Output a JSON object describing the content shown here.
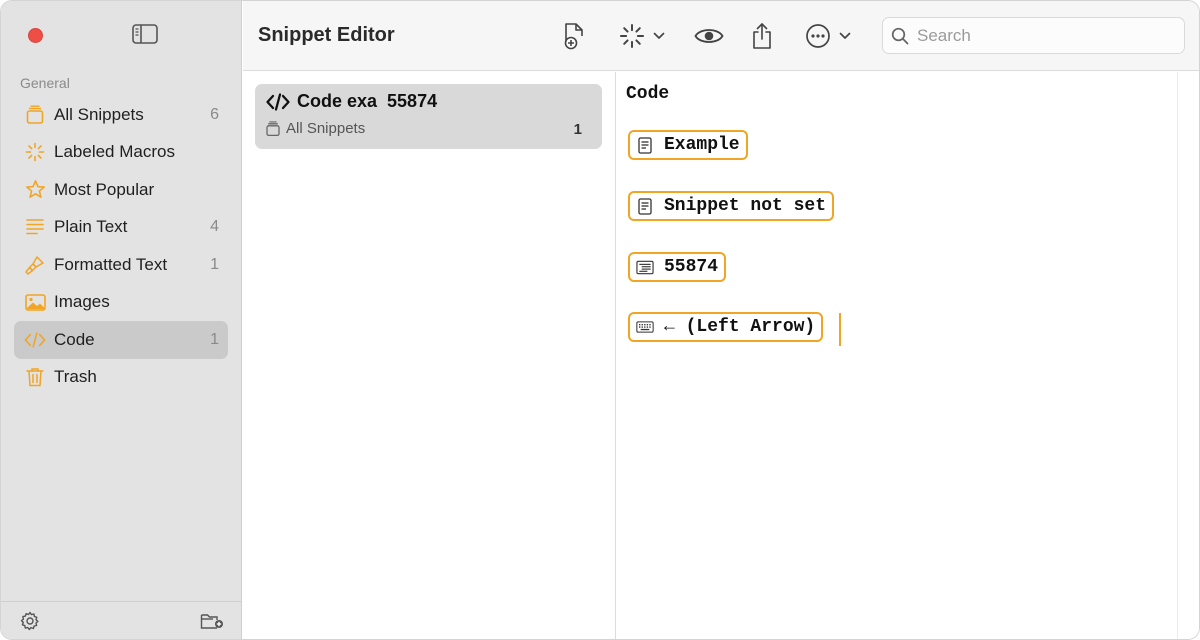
{
  "sidebar": {
    "section_label": "General",
    "items": [
      {
        "label": "All Snippets",
        "count": "6",
        "icon": "stack-icon"
      },
      {
        "label": "Labeled Macros",
        "count": "",
        "icon": "sparkle-icon"
      },
      {
        "label": "Most Popular",
        "count": "",
        "icon": "star-icon"
      },
      {
        "label": "Plain Text",
        "count": "4",
        "icon": "lines-icon"
      },
      {
        "label": "Formatted Text",
        "count": "1",
        "icon": "brush-icon"
      },
      {
        "label": "Images",
        "count": "",
        "icon": "photo-icon"
      },
      {
        "label": "Code",
        "count": "1",
        "icon": "code-icon"
      },
      {
        "label": "Trash",
        "count": "",
        "icon": "trash-icon"
      }
    ],
    "active_index": 6
  },
  "toolbar": {
    "title": "Snippet Editor",
    "search_placeholder": "Search"
  },
  "list": {
    "snippet_title": "Code exa  55874",
    "snippet_group": "All Snippets",
    "snippet_count": "1"
  },
  "editor": {
    "title": "Code",
    "tokens": [
      {
        "text": "Example",
        "icon": "document-icon"
      },
      {
        "text": "Snippet not set",
        "icon": "document-icon"
      },
      {
        "text": "55874",
        "icon": "text-block-icon"
      },
      {
        "text": "← (Left Arrow)",
        "icon": "keyboard-icon"
      }
    ]
  },
  "colors": {
    "accent": "#f0a525",
    "close_button": "#ed4e45",
    "sidebar_bg": "#e3e3e3",
    "active_item_bg": "#cacaca"
  }
}
